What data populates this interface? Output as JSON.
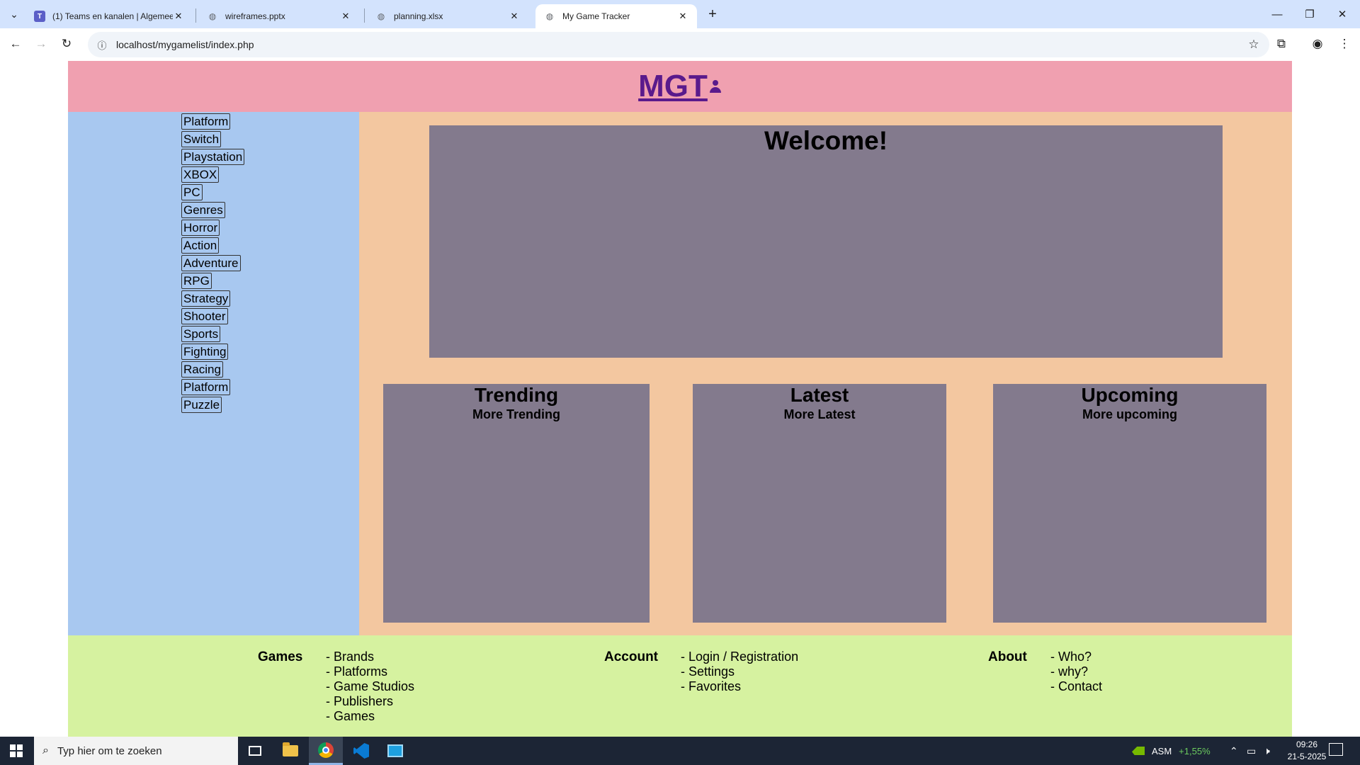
{
  "browser": {
    "tabs": [
      {
        "title": "(1) Teams en kanalen | Algemee",
        "favicon": "teams-icon",
        "active": false
      },
      {
        "title": "wireframes.pptx",
        "favicon": "globe-icon",
        "active": false
      },
      {
        "title": "planning.xlsx",
        "favicon": "globe-icon",
        "active": false
      },
      {
        "title": "My Game Tracker",
        "favicon": "globe-icon",
        "active": true
      }
    ],
    "url": "localhost/mygamelist/index.php"
  },
  "page": {
    "logo": "MGT",
    "sidebar": {
      "items": [
        "Platform",
        "Switch",
        "Playstation",
        "XBOX",
        "PC",
        "Genres",
        "Horror",
        "Action",
        "Adventure",
        "RPG",
        "Strategy",
        "Shooter",
        "Sports",
        "Fighting",
        "Racing",
        "Platform",
        "Puzzle"
      ]
    },
    "welcome": {
      "title": "Welcome!"
    },
    "cards": [
      {
        "title": "Trending",
        "more": "More Trending"
      },
      {
        "title": "Latest",
        "more": "More Latest"
      },
      {
        "title": "Upcoming",
        "more": "More upcoming"
      }
    ],
    "footer": {
      "games": {
        "heading": "Games",
        "links": [
          "- Brands",
          "- Platforms",
          "- Game Studios",
          "- Publishers",
          "- Games"
        ]
      },
      "account": {
        "heading": "Account",
        "links": [
          "- Login / Registration",
          "- Settings",
          "- Favorites"
        ]
      },
      "about": {
        "heading": "About",
        "links": [
          "- Who?",
          "- why?",
          "- Contact"
        ]
      }
    },
    "colors": {
      "header": "#f0a0b0",
      "sidebar": "#a8c8f0",
      "main": "#f3c7a0",
      "panel": "#837a8d",
      "footer": "#d6f2a0",
      "logo": "#5a1a8c"
    }
  },
  "taskbar": {
    "search_placeholder": "Typ hier om te zoeken",
    "stock_name": "ASM",
    "stock_change": "+1,55%",
    "time": "09:26",
    "date": "21-5-2025"
  }
}
